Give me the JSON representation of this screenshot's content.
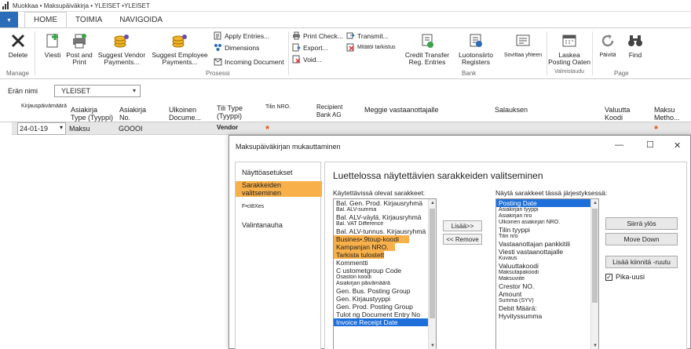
{
  "window": {
    "title": "Muokkaa • Maksupäiväkirja • YLEISET •YLEISET"
  },
  "tabs": [
    {
      "label": "HOME"
    },
    {
      "label": "TOIMIA"
    },
    {
      "label": "NAVIGOIDA"
    }
  ],
  "file_menu": {
    "label": "▾"
  },
  "ribbon": {
    "delete": "Delete",
    "manage_group": "Manage",
    "viesti": "Viesti",
    "post_and_print": "Post and Print",
    "suggest_vendor": "Suggest Vendor Payments...",
    "suggest_employee": "Suggest Employee Payments...",
    "apply_entries": "Apply Entries...",
    "dimensions": "Dimensions",
    "incoming_document": "Incoming Document",
    "prosessi_group": "Prosessi",
    "print_check": "Print Check...",
    "export": "Export...",
    "void": "Void...",
    "transmit": "Transmit...",
    "mitatoi": "Mitätöi tarkistus",
    "credit_transfer": "Credit Transfer Reg. Entries",
    "luotonsiirto": "Luotonsiirto Registers",
    "sovittaa": "Sovittaa yhteen",
    "bank_group": "Bank",
    "laskea": "Laskea Posting Oaten",
    "valmistaudu": "Valmistaudu",
    "paivita": "Päivitä",
    "find": "Find",
    "page_group": "Page"
  },
  "batch": {
    "label": "Erän nimi",
    "value": "YLEISET"
  },
  "grid": {
    "headers": {
      "posting_date": "Kirjauspäivämäärä",
      "doc_type": "Asiakirja Type (Tyyppi)",
      "doc_no": "Asiakirja No.",
      "ext_doc": "Ulkoinen Documе...",
      "account_type": "Tili Type (Tyyppi)",
      "account_no": "Tilin NRO.",
      "recipient_bank": "Recipient Bank AG",
      "meggie": "Meggie vastaanottajalle",
      "salauksen": "Salauksen",
      "currency": "Valuutta Koodi",
      "payment_method": "Maksu Metho..."
    },
    "row": {
      "date": "24-01-19",
      "doc_type": "Maksu",
      "doc_no": "GOOOI",
      "account_type": "Vendor",
      "required_mark": "*"
    }
  },
  "dialog": {
    "title": "Maksupäiväkirjan mukauttaminen",
    "nav": [
      "Näyttöasetukset",
      "Sarakkeiden valitseminen",
      "F•ct8Xes",
      "Valintanauha"
    ],
    "content_title": "Luettelossa näytettävien sarakkeiden valitseminen",
    "available_label": "Käytettävissä olevat sarakkeet:",
    "shown_label": "Näytä sarakkeet tässä järjestyksessä:",
    "available": [
      "Bal. Gen. Prod. Kirjausryhmä",
      "Bal. ALV-summa",
      "Bal. ALV-väylä. Kirjausryhmä",
      "Bal. VAT Difference",
      "Bal. ALV-tunnus. Kirjausryhmä",
      "Busines•.9toup-koodi",
      "Kampanjan NRO.",
      "Tarkista tulostettu",
      "Kommentti",
      "C ustometgroup Code",
      "Osaston koodi",
      "Asiakirjan päivämäärä",
      "Gen. Bus. Posting Group",
      "Gen. Kirjaustyyppi",
      "Gen. Prod. Posting Group",
      "Tulot ng Document Entry No",
      "Invoice Receipt Date"
    ],
    "shown": [
      "Posting Date",
      "Asiakirjan tyyppi",
      "Asiakirjan nro",
      "Ulkoinen asiakirjan NRO.",
      "Tilin tyyppi",
      "Tilin nro",
      "Vastaanottajan pankkitili",
      "Viesti vastaanottajalle",
      "Kuvaus",
      "Valuuttakoodi",
      "Maksutapakoodi",
      "Maksuviite",
      "Crestor NO.",
      "Amount",
      "Summa (SYV)",
      "Debit Määrä:",
      "Hyvityssumma"
    ],
    "add_btn": "Lisää>>",
    "remove_btn": "<< Remove",
    "move_up": "Siirrä ylös",
    "move_down": "Move Down",
    "add_pinned": "Lisää kiinnitä -ruutu",
    "quick_label": "Pika-uusi",
    "quick_checked": "✓"
  }
}
